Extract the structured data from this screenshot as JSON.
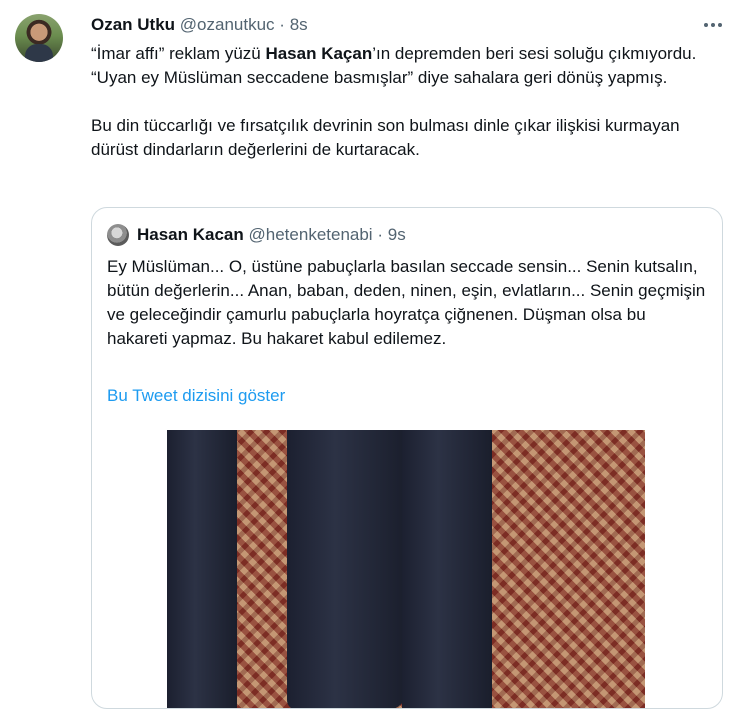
{
  "tweet": {
    "author_name": "Ozan Utku",
    "author_handle": "@ozanutkuc",
    "separator": "·",
    "time": "8s",
    "text_line1_a": "“İmar affı” reklam yüzü ",
    "text_line1_bold": "Hasan Kaçan",
    "text_line1_b": "’ın depremden beri sesi soluğu çıkmıyordu. “Uyan ey Müslüman seccadene basmışlar” diye sahalara geri dönüş yapmış.",
    "text_para2": "Bu din tüccarlığı ve fırsatçılık devrinin son bulması dinle çıkar ilişkisi kurmayan dürüst dindarların değerlerini de kurtaracak."
  },
  "quoted": {
    "author_name": "Hasan Kacan",
    "author_handle": "@hetenketenabi",
    "separator": "·",
    "time": "9s",
    "text": "Ey Müslüman... O, üstüne pabuçlarla basılan seccade sensin... Senin kutsalın, bütün değerlerin... Anan, baban, deden, ninen, eşin, evlatların... Senin geçmişin ve geleceğindir çamurlu pabuçlarla hoyratça çiğnenen. Düşman olsa bu hakareti yapmaz. Bu hakaret kabul edilemez.",
    "thread_link": "Bu Tweet dizisini göster"
  }
}
